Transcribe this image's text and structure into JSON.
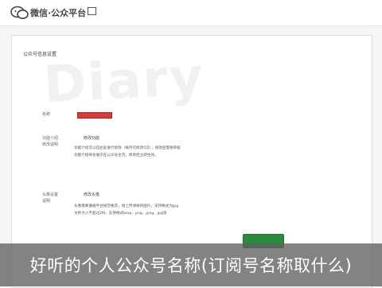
{
  "header": {
    "brand": "微信·公众平台",
    "logo_icon": "wechat-icon"
  },
  "panel": {
    "title": "公众号信息设置",
    "watermark": "Diary",
    "name_label": "名称",
    "name_value_color": "#d83a3a",
    "intro_label_1": "功能介绍",
    "intro_label_2": "修改说明",
    "intro_value": "修改功能",
    "intro_hint_1": "功能介绍可以在此处进行修改（每月可修改5次），修改后需要审核",
    "intro_hint_2": "功能介绍将会展示在公众号主页，修改后立即生效。",
    "avatar_label_1": "头像设置",
    "avatar_label_2": "说明",
    "avatar_value": "修改头像",
    "avatar_hint_1": "头像需要遵循平台规范要求，请上传清晰的图片，支持格式为jpg",
    "avatar_hint_2": "文件大小不超过2M，支持格式bmp、png、jpeg、jpg等"
  },
  "colors": {
    "accent_green": "#2c8a3c",
    "name_red": "#d83a3a"
  },
  "caption": "好听的个人公众号名称(订阅号名称取什么)"
}
